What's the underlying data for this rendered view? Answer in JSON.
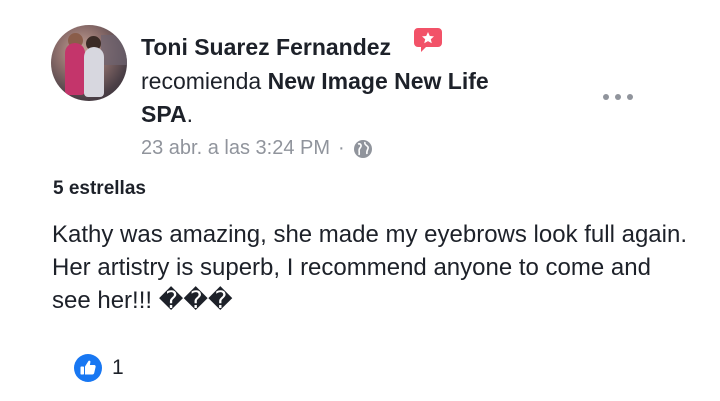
{
  "post": {
    "author": "Toni Suarez Fernandez",
    "verb": "recomienda",
    "page_line1": "New Image New Life",
    "page_line2": "SPA",
    "period": ".",
    "timestamp": "23 abr. a las 3:24 PM",
    "separator": "·",
    "privacy_icon": "globe-icon",
    "rating": "5 estrellas",
    "text": "Kathy was amazing, she made my eyebrows look full again. Her artistry is superb, I recommend anyone to come and see her!!! ���",
    "reactions": {
      "like_count": "1",
      "icon": "like-icon"
    }
  },
  "colors": {
    "recommend_badge": "#f25268",
    "meta_gray": "#90949c",
    "like_blue": "#1877f2"
  }
}
